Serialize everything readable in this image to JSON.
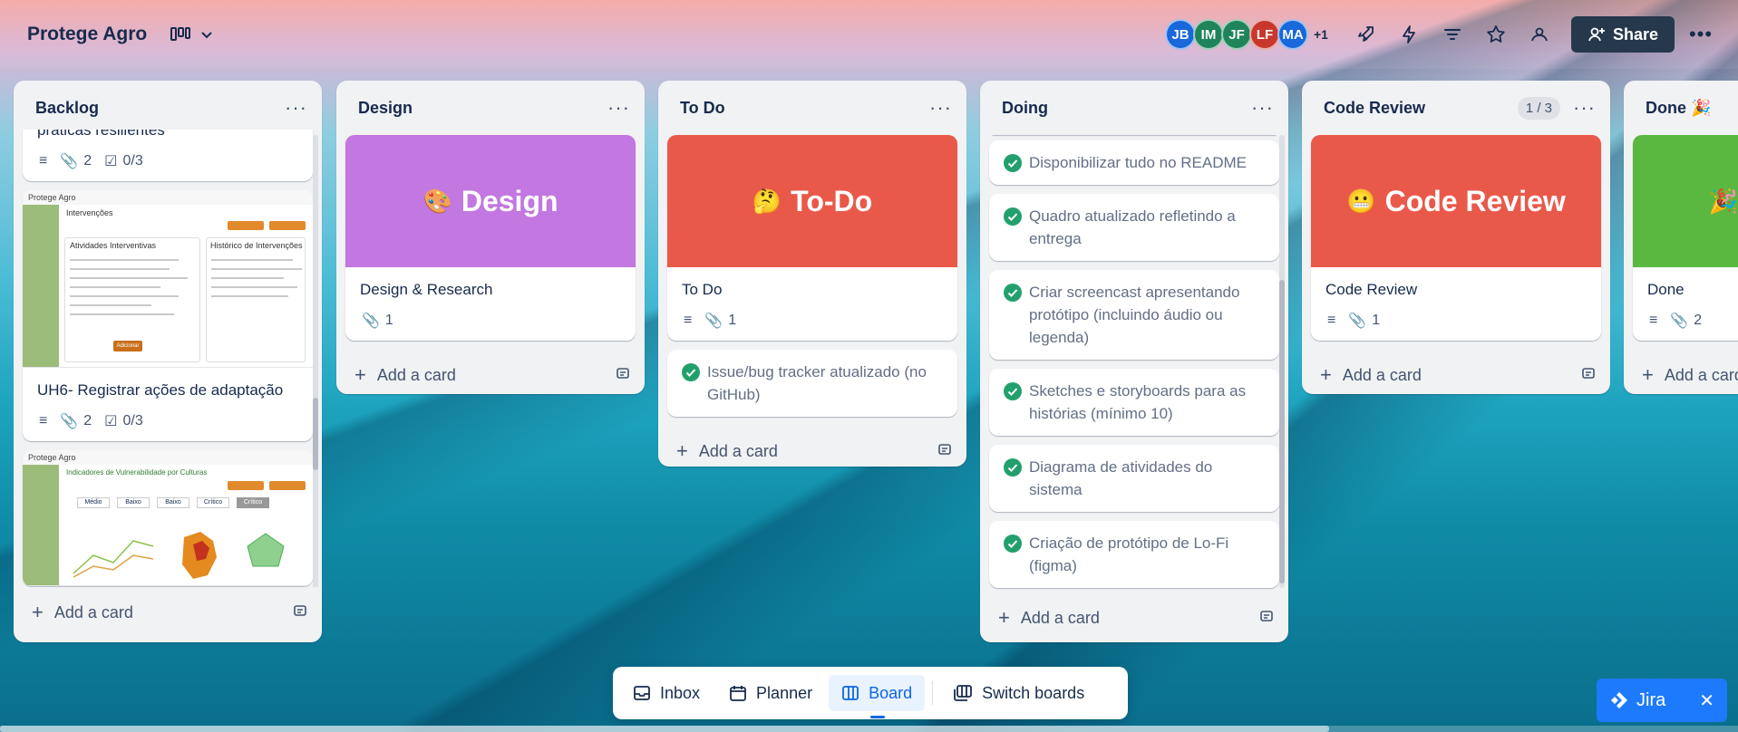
{
  "header": {
    "board_title": "Protege Agro",
    "avatars": [
      {
        "initials": "JB",
        "color": "#1868db"
      },
      {
        "initials": "IM",
        "color": "#1f845a"
      },
      {
        "initials": "JF",
        "color": "#1f845a"
      },
      {
        "initials": "LF",
        "color": "#c9372c"
      },
      {
        "initials": "MA",
        "color": "#1868db"
      }
    ],
    "avatars_more": "+1",
    "share_label": "Share"
  },
  "lists": {
    "backlog": {
      "title": "Backlog",
      "card1": {
        "title": "práticas resilientes",
        "attachments": "2",
        "checklist": "0/3"
      },
      "card2": {
        "title": "UH6- Registrar ações de adaptação",
        "attachments": "2",
        "checklist": "0/3"
      },
      "shot1": {
        "brand": "Protege Agro",
        "heading": "Intervenções",
        "left_panel": "Atividades Interventivas",
        "right_panel": "Histórico de Intervenções",
        "button": "Adicionar"
      },
      "shot2": {
        "brand": "Protege Agro",
        "heading": "Indicadores de Vulnerabilidade por Culturas",
        "tag1": "Médio",
        "tag2": "Baixo",
        "tag3": "Baixo",
        "tag4": "Crítico",
        "tag5": "Crítico"
      },
      "add_card": "Add a card"
    },
    "design": {
      "title": "Design",
      "cover_emoji": "🎨",
      "cover_text": "Design",
      "cover_color": "#c377e0",
      "card_title": "Design & Research",
      "attachments": "1",
      "add_card": "Add a card"
    },
    "todo": {
      "title": "To Do",
      "cover_emoji": "🤔",
      "cover_text": "To-Do",
      "cover_color": "#e9594a",
      "card_title": "To Do",
      "attachments": "1",
      "card2_title": "Issue/bug tracker atualizado (no GitHub)",
      "add_card": "Add a card"
    },
    "doing": {
      "title": "Doing",
      "items": [
        "Disponibilizar tudo no README",
        "Quadro atualizado refletindo a entrega",
        "Criar screencast apresentando protótipo (incluindo áudio ou legenda)",
        "Sketches e storyboards para as histórias (mínimo 10)",
        "Diagrama de atividades do sistema",
        "Criação de protótipo de Lo-Fi (figma)"
      ],
      "add_card": "Add a card"
    },
    "code_review": {
      "title": "Code Review",
      "count": "1 / 3",
      "cover_emoji": "😬",
      "cover_text": "Code Review",
      "cover_color": "#e9594a",
      "card_title": "Code Review",
      "attachments": "1",
      "add_card": "Add a card"
    },
    "done": {
      "title": "Done 🎉",
      "cover_emoji": "🎉",
      "cover_color": "#5ab841",
      "card_title": "Done",
      "attachments": "2",
      "add_card": "Add a card"
    }
  },
  "bottom_nav": {
    "inbox": "Inbox",
    "planner": "Planner",
    "board": "Board",
    "switch": "Switch boards"
  },
  "jira": {
    "label": "Jira"
  }
}
